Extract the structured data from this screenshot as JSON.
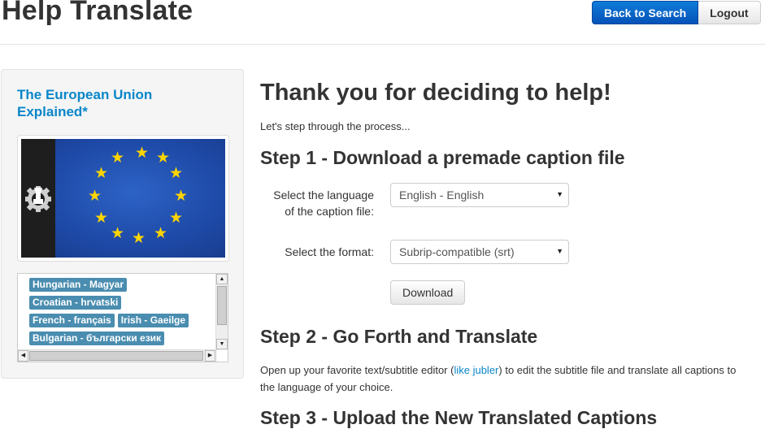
{
  "header": {
    "title": "Help Translate",
    "back_button": "Back to Search",
    "logout_button": "Logout"
  },
  "sidebar": {
    "video_title": "The European Union Explained*",
    "languages": [
      "Hungarian - Magyar",
      "Croatian - hrvatski",
      "French - français",
      "Irish - Gaeilge",
      "Bulgarian - български език"
    ]
  },
  "main": {
    "heading": "Thank you for deciding to help!",
    "intro": "Let's step through the process...",
    "step1": {
      "heading": "Step 1 - Download a premade caption file",
      "language_label_line1": "Select the language",
      "language_label_line2": "of the caption file:",
      "language_value": "English - English",
      "format_label": "Select the format:",
      "format_value": "Subrip-compatible (srt)",
      "download_button": "Download"
    },
    "step2": {
      "heading": "Step 2 - Go Forth and Translate",
      "text_before": "Open up your favorite text/subtitle editor (",
      "link": "like jubler",
      "text_after": ") to edit the subtitle file and translate all captions to the language of your choice."
    },
    "step3": {
      "heading": "Step 3 - Upload the New Translated Captions"
    }
  },
  "colors": {
    "primary_button": "#0552b8",
    "link": "#0a86c9",
    "tag": "#4a8db0",
    "flag_blue": "#1e4aa8",
    "flag_star": "#ffd400"
  }
}
